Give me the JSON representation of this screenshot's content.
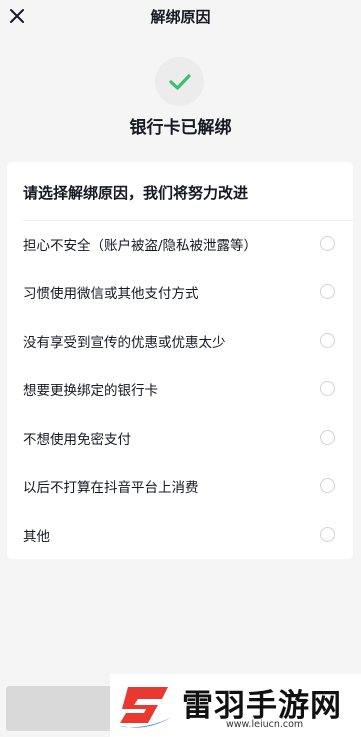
{
  "header": {
    "title": "解绑原因",
    "close_icon": "close-icon"
  },
  "status": {
    "icon": "checkmark-icon",
    "icon_color": "#3bbf6e",
    "title": "银行卡已解绑"
  },
  "reasons": {
    "heading": "请选择解绑原因，我们将努力改进",
    "items": [
      {
        "label": "担心不安全（账户被盗/隐私被泄露等）",
        "selected": false
      },
      {
        "label": "习惯使用微信或其他支付方式",
        "selected": false
      },
      {
        "label": "没有享受到宣传的优惠或优惠太少",
        "selected": false
      },
      {
        "label": "想要更换绑定的银行卡",
        "selected": false
      },
      {
        "label": "不想使用免密支付",
        "selected": false
      },
      {
        "label": "以后不打算在抖音平台上消费",
        "selected": false
      },
      {
        "label": "其他",
        "selected": false
      }
    ]
  },
  "watermark": {
    "logo_text": "雷羽手游网",
    "url": "www.leiucn.com",
    "logo_colors": [
      "#e8382f",
      "#2f8ae6"
    ]
  }
}
